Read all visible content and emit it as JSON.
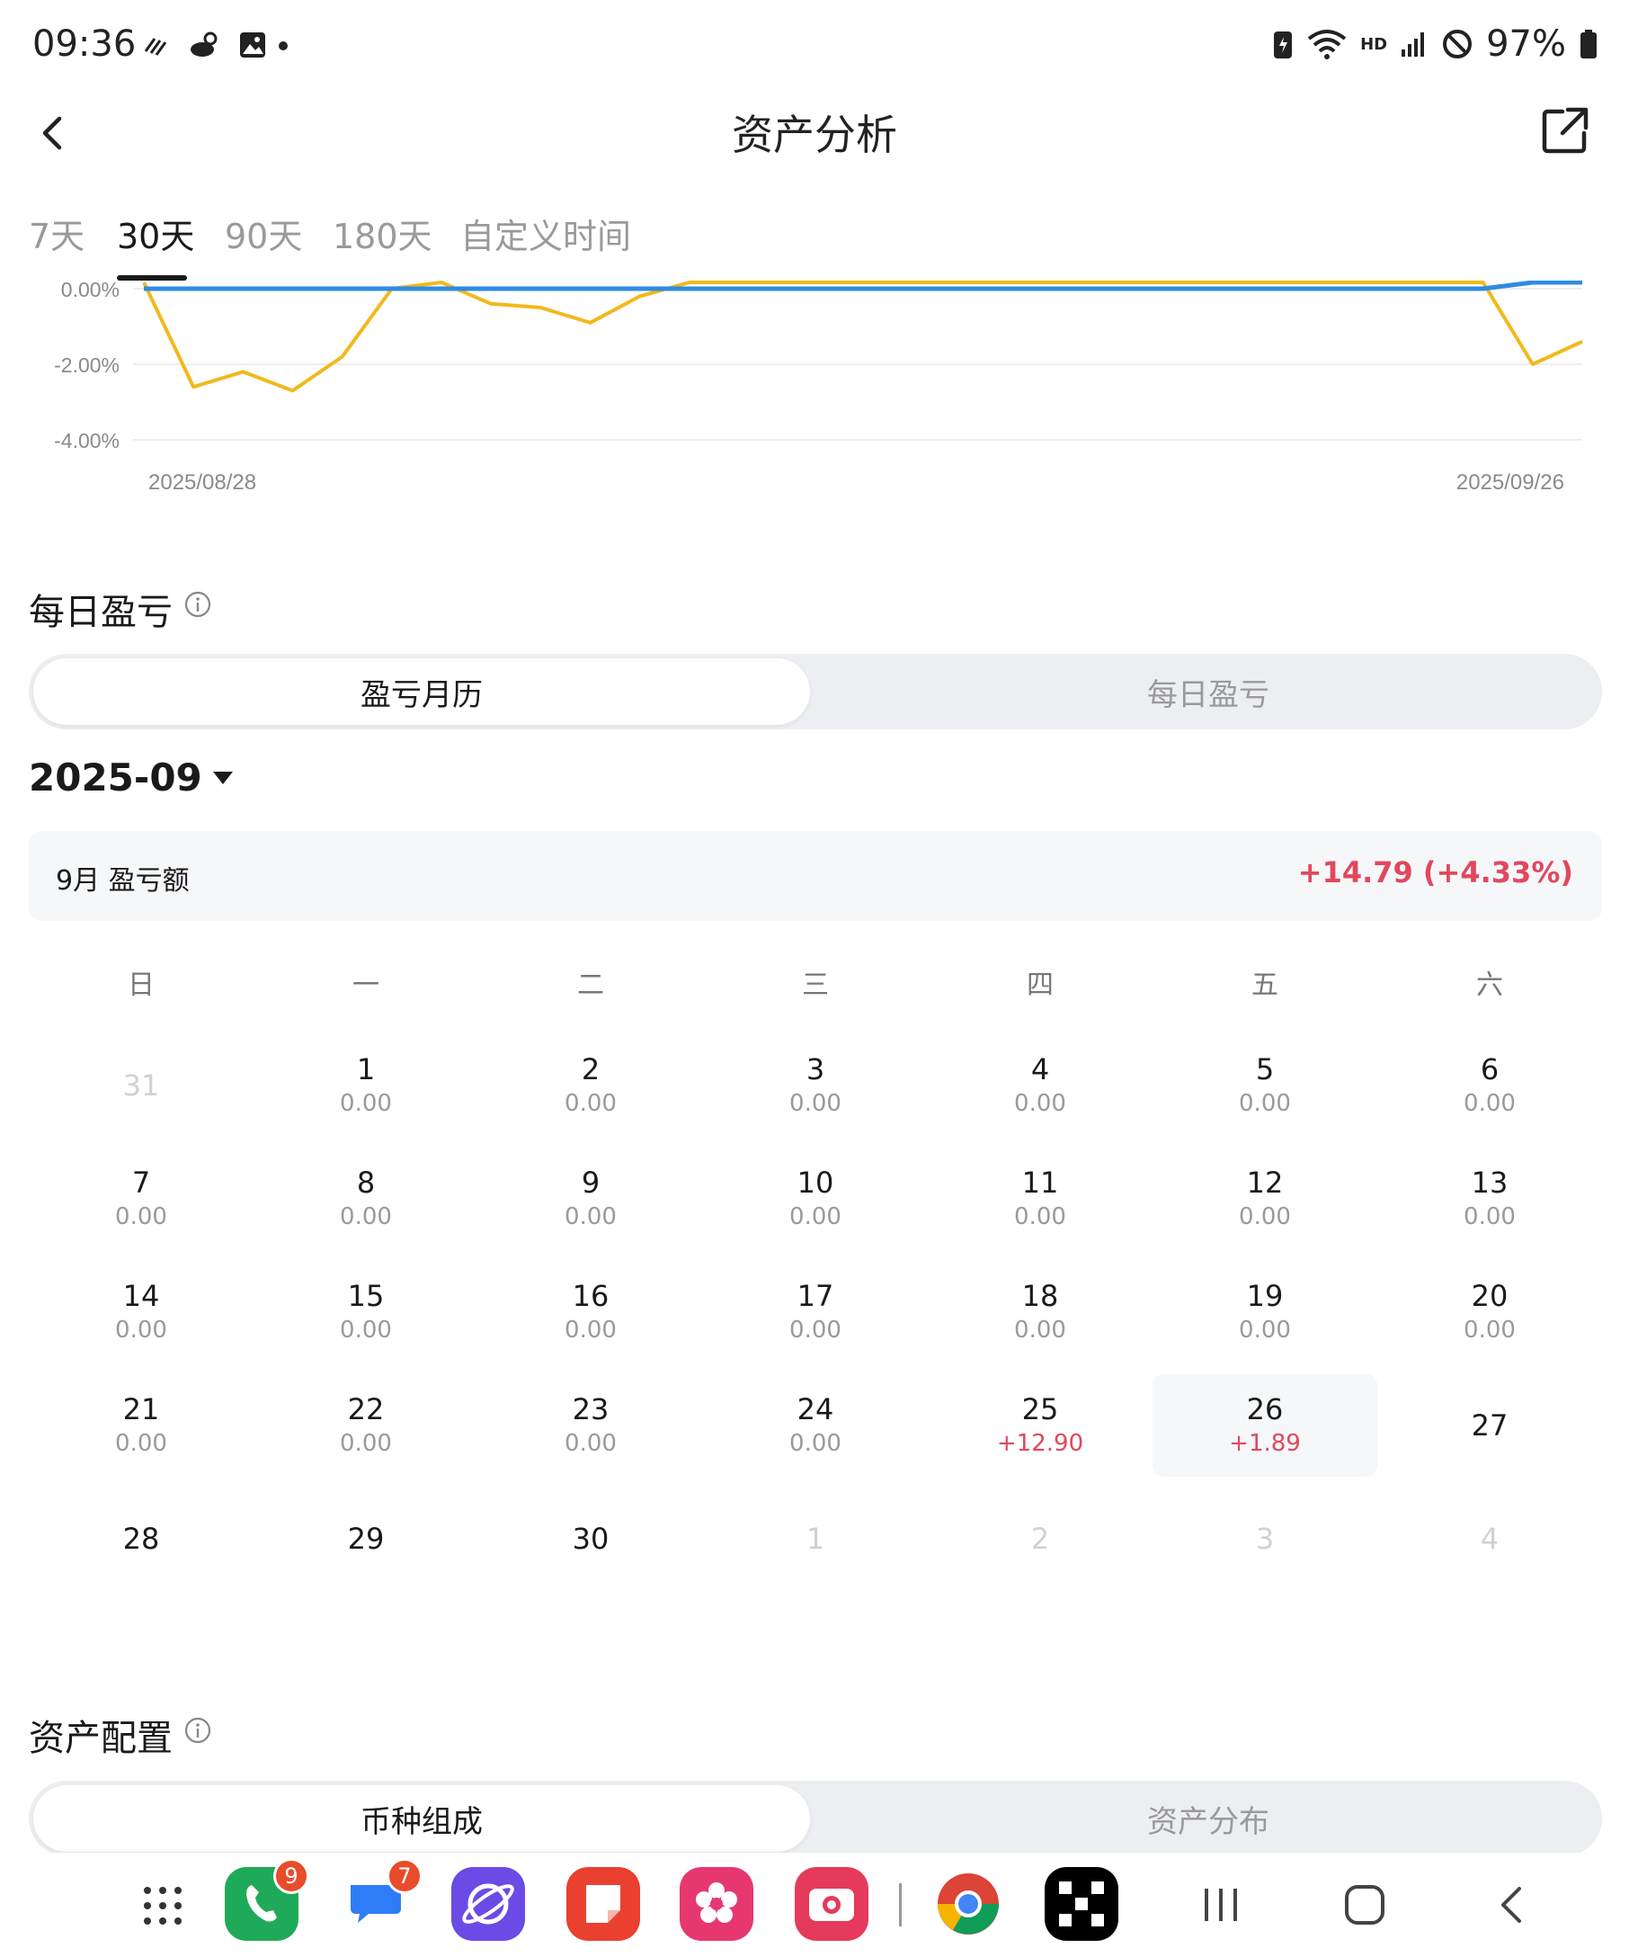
{
  "status_bar": {
    "time": "09:36",
    "network_label": "HD",
    "battery": "97%"
  },
  "header": {
    "title": "资产分析",
    "back_icon": "chevron-left-icon",
    "share_icon": "share-external-icon"
  },
  "tabs": [
    {
      "label": "7天",
      "active": false
    },
    {
      "label": "30天",
      "active": true
    },
    {
      "label": "90天",
      "active": false
    },
    {
      "label": "180天",
      "active": false
    },
    {
      "label": "自定义时间",
      "active": false
    }
  ],
  "chart_data": {
    "type": "line",
    "yticks": [
      "0.00%",
      "-2.00%",
      "-4.00%"
    ],
    "ylim": [
      -4.5,
      0.3
    ],
    "x_start_label": "2025/08/28",
    "x_end_label": "2025/09/26",
    "grid": true,
    "series": [
      {
        "color": "#f2b91c",
        "values": [
          0.3,
          -2.6,
          -2.2,
          -2.7,
          -1.8,
          0.0,
          0.3,
          -0.4,
          -0.5,
          -0.9,
          -0.2,
          0.3,
          0.3,
          0.3,
          0.3,
          0.3,
          0.3,
          0.3,
          0.3,
          0.3,
          0.3,
          0.3,
          0.3,
          0.3,
          0.3,
          0.3,
          0.3,
          0.3,
          -2.0,
          -1.4
        ]
      },
      {
        "color": "#2f8be0",
        "values": [
          0,
          0,
          0,
          0,
          0,
          0,
          0,
          0,
          0,
          0,
          0,
          0,
          0,
          0,
          0,
          0,
          0,
          0,
          0,
          0,
          0,
          0,
          0,
          0,
          0,
          0,
          0,
          0,
          0.3,
          0.3
        ]
      }
    ]
  },
  "daily_pnl": {
    "title": "每日盈亏",
    "info_icon": "info-icon",
    "segments": [
      {
        "label": "盈亏月历",
        "active": true
      },
      {
        "label": "每日盈亏",
        "active": false
      }
    ],
    "month": "2025-09",
    "summary_label": "9月 盈亏额",
    "summary_value": "+14.79 (+4.33%)",
    "positive_color": "#e0485e",
    "weekdays": [
      "日",
      "一",
      "二",
      "三",
      "四",
      "五",
      "六"
    ],
    "weeks": [
      [
        {
          "day": "31",
          "value": "",
          "muted": true
        },
        {
          "day": "1",
          "value": "0.00"
        },
        {
          "day": "2",
          "value": "0.00"
        },
        {
          "day": "3",
          "value": "0.00"
        },
        {
          "day": "4",
          "value": "0.00"
        },
        {
          "day": "5",
          "value": "0.00"
        },
        {
          "day": "6",
          "value": "0.00"
        }
      ],
      [
        {
          "day": "7",
          "value": "0.00"
        },
        {
          "day": "8",
          "value": "0.00"
        },
        {
          "day": "9",
          "value": "0.00"
        },
        {
          "day": "10",
          "value": "0.00"
        },
        {
          "day": "11",
          "value": "0.00"
        },
        {
          "day": "12",
          "value": "0.00"
        },
        {
          "day": "13",
          "value": "0.00"
        }
      ],
      [
        {
          "day": "14",
          "value": "0.00"
        },
        {
          "day": "15",
          "value": "0.00"
        },
        {
          "day": "16",
          "value": "0.00"
        },
        {
          "day": "17",
          "value": "0.00"
        },
        {
          "day": "18",
          "value": "0.00"
        },
        {
          "day": "19",
          "value": "0.00"
        },
        {
          "day": "20",
          "value": "0.00"
        }
      ],
      [
        {
          "day": "21",
          "value": "0.00"
        },
        {
          "day": "22",
          "value": "0.00"
        },
        {
          "day": "23",
          "value": "0.00"
        },
        {
          "day": "24",
          "value": "0.00"
        },
        {
          "day": "25",
          "value": "+12.90",
          "positive": true
        },
        {
          "day": "26",
          "value": "+1.89",
          "positive": true,
          "highlight": true
        },
        {
          "day": "27",
          "value": ""
        }
      ],
      [
        {
          "day": "28",
          "value": ""
        },
        {
          "day": "29",
          "value": ""
        },
        {
          "day": "30",
          "value": ""
        },
        {
          "day": "1",
          "value": "",
          "muted": true
        },
        {
          "day": "2",
          "value": "",
          "muted": true
        },
        {
          "day": "3",
          "value": "",
          "muted": true
        },
        {
          "day": "4",
          "value": "",
          "muted": true
        }
      ]
    ]
  },
  "asset_allocation": {
    "title": "资产配置",
    "info_icon": "info-icon",
    "segments": [
      {
        "label": "币种组成",
        "active": true
      },
      {
        "label": "资产分布",
        "active": false
      }
    ]
  },
  "nav_bar": {
    "apps": [
      {
        "name": "app-drawer-icon"
      },
      {
        "name": "phone-app-icon",
        "badge": "9",
        "color": "#1faa59"
      },
      {
        "name": "messages-app-icon",
        "badge": "7",
        "color": "#2f7df6"
      },
      {
        "name": "internet-app-icon",
        "color": "#6a4be6"
      },
      {
        "name": "notes-app-icon",
        "color": "#e9402f"
      },
      {
        "name": "gallery-app-icon",
        "color": "#e6386e"
      },
      {
        "name": "camera-app-icon",
        "color": "#e53a5c"
      },
      {
        "name": "chrome-app-icon"
      },
      {
        "name": "okx-app-icon",
        "color": "#000000"
      }
    ],
    "buttons": [
      "recents-icon",
      "home-icon",
      "back-icon"
    ]
  }
}
